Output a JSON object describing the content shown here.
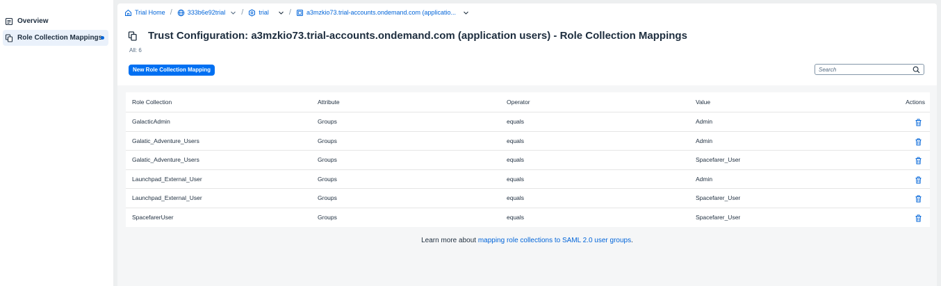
{
  "sidebar": {
    "items": [
      {
        "label": "Overview",
        "icon": "overview-icon"
      },
      {
        "label": "Role Collection Mappings",
        "icon": "mapping-icon",
        "active": true
      }
    ]
  },
  "breadcrumb": [
    {
      "label": "Trial Home",
      "icon": "home-icon"
    },
    {
      "label": "333b6e92trial",
      "icon": "globe-icon",
      "dropdown": true
    },
    {
      "label": "trial",
      "icon": "subaccount-icon",
      "dropdown": true
    },
    {
      "label": "a3mzkio73.trial-accounts.ondemand.com (applicatio...",
      "icon": "trust-icon",
      "dropdown": true
    }
  ],
  "page": {
    "title": "Trust Configuration: a3mzkio73.trial-accounts.ondemand.com (application users) - Role Collection Mappings",
    "count": "All: 6",
    "new_button": "New Role Collection Mapping",
    "search_placeholder": "Search"
  },
  "table": {
    "headers": [
      "Role Collection",
      "Attribute",
      "Operator",
      "Value",
      "Actions"
    ],
    "rows": [
      [
        "GalacticAdmin",
        "Groups",
        "equals",
        "Admin"
      ],
      [
        "Galatic_Adventure_Users",
        "Groups",
        "equals",
        "Admin"
      ],
      [
        "Galatic_Adventure_Users",
        "Groups",
        "equals",
        "Spacefarer_User"
      ],
      [
        "Launchpad_External_User",
        "Groups",
        "equals",
        "Admin"
      ],
      [
        "Launchpad_External_User",
        "Groups",
        "equals",
        "Spacefarer_User"
      ],
      [
        "SpacefarerUser",
        "Groups",
        "equals",
        "Spacefarer_User"
      ]
    ]
  },
  "footer": {
    "prefix": "Learn more about ",
    "link": "mapping role collections to SAML 2.0 user groups",
    "suffix": "."
  },
  "colors": {
    "accent": "#0070f2",
    "link": "#0064d9",
    "background": "#edeff0"
  }
}
